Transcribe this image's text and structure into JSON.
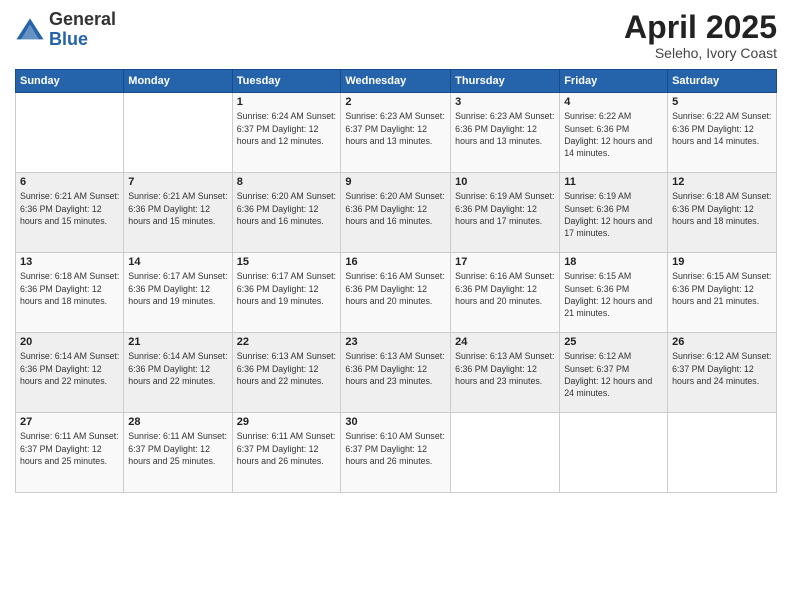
{
  "header": {
    "logo_general": "General",
    "logo_blue": "Blue",
    "month_title": "April 2025",
    "subtitle": "Seleho, Ivory Coast"
  },
  "weekdays": [
    "Sunday",
    "Monday",
    "Tuesday",
    "Wednesday",
    "Thursday",
    "Friday",
    "Saturday"
  ],
  "weeks": [
    [
      {
        "day": "",
        "info": ""
      },
      {
        "day": "",
        "info": ""
      },
      {
        "day": "1",
        "info": "Sunrise: 6:24 AM\nSunset: 6:37 PM\nDaylight: 12 hours and 12 minutes."
      },
      {
        "day": "2",
        "info": "Sunrise: 6:23 AM\nSunset: 6:37 PM\nDaylight: 12 hours and 13 minutes."
      },
      {
        "day": "3",
        "info": "Sunrise: 6:23 AM\nSunset: 6:36 PM\nDaylight: 12 hours and 13 minutes."
      },
      {
        "day": "4",
        "info": "Sunrise: 6:22 AM\nSunset: 6:36 PM\nDaylight: 12 hours and 14 minutes."
      },
      {
        "day": "5",
        "info": "Sunrise: 6:22 AM\nSunset: 6:36 PM\nDaylight: 12 hours and 14 minutes."
      }
    ],
    [
      {
        "day": "6",
        "info": "Sunrise: 6:21 AM\nSunset: 6:36 PM\nDaylight: 12 hours and 15 minutes."
      },
      {
        "day": "7",
        "info": "Sunrise: 6:21 AM\nSunset: 6:36 PM\nDaylight: 12 hours and 15 minutes."
      },
      {
        "day": "8",
        "info": "Sunrise: 6:20 AM\nSunset: 6:36 PM\nDaylight: 12 hours and 16 minutes."
      },
      {
        "day": "9",
        "info": "Sunrise: 6:20 AM\nSunset: 6:36 PM\nDaylight: 12 hours and 16 minutes."
      },
      {
        "day": "10",
        "info": "Sunrise: 6:19 AM\nSunset: 6:36 PM\nDaylight: 12 hours and 17 minutes."
      },
      {
        "day": "11",
        "info": "Sunrise: 6:19 AM\nSunset: 6:36 PM\nDaylight: 12 hours and 17 minutes."
      },
      {
        "day": "12",
        "info": "Sunrise: 6:18 AM\nSunset: 6:36 PM\nDaylight: 12 hours and 18 minutes."
      }
    ],
    [
      {
        "day": "13",
        "info": "Sunrise: 6:18 AM\nSunset: 6:36 PM\nDaylight: 12 hours and 18 minutes."
      },
      {
        "day": "14",
        "info": "Sunrise: 6:17 AM\nSunset: 6:36 PM\nDaylight: 12 hours and 19 minutes."
      },
      {
        "day": "15",
        "info": "Sunrise: 6:17 AM\nSunset: 6:36 PM\nDaylight: 12 hours and 19 minutes."
      },
      {
        "day": "16",
        "info": "Sunrise: 6:16 AM\nSunset: 6:36 PM\nDaylight: 12 hours and 20 minutes."
      },
      {
        "day": "17",
        "info": "Sunrise: 6:16 AM\nSunset: 6:36 PM\nDaylight: 12 hours and 20 minutes."
      },
      {
        "day": "18",
        "info": "Sunrise: 6:15 AM\nSunset: 6:36 PM\nDaylight: 12 hours and 21 minutes."
      },
      {
        "day": "19",
        "info": "Sunrise: 6:15 AM\nSunset: 6:36 PM\nDaylight: 12 hours and 21 minutes."
      }
    ],
    [
      {
        "day": "20",
        "info": "Sunrise: 6:14 AM\nSunset: 6:36 PM\nDaylight: 12 hours and 22 minutes."
      },
      {
        "day": "21",
        "info": "Sunrise: 6:14 AM\nSunset: 6:36 PM\nDaylight: 12 hours and 22 minutes."
      },
      {
        "day": "22",
        "info": "Sunrise: 6:13 AM\nSunset: 6:36 PM\nDaylight: 12 hours and 22 minutes."
      },
      {
        "day": "23",
        "info": "Sunrise: 6:13 AM\nSunset: 6:36 PM\nDaylight: 12 hours and 23 minutes."
      },
      {
        "day": "24",
        "info": "Sunrise: 6:13 AM\nSunset: 6:36 PM\nDaylight: 12 hours and 23 minutes."
      },
      {
        "day": "25",
        "info": "Sunrise: 6:12 AM\nSunset: 6:37 PM\nDaylight: 12 hours and 24 minutes."
      },
      {
        "day": "26",
        "info": "Sunrise: 6:12 AM\nSunset: 6:37 PM\nDaylight: 12 hours and 24 minutes."
      }
    ],
    [
      {
        "day": "27",
        "info": "Sunrise: 6:11 AM\nSunset: 6:37 PM\nDaylight: 12 hours and 25 minutes."
      },
      {
        "day": "28",
        "info": "Sunrise: 6:11 AM\nSunset: 6:37 PM\nDaylight: 12 hours and 25 minutes."
      },
      {
        "day": "29",
        "info": "Sunrise: 6:11 AM\nSunset: 6:37 PM\nDaylight: 12 hours and 26 minutes."
      },
      {
        "day": "30",
        "info": "Sunrise: 6:10 AM\nSunset: 6:37 PM\nDaylight: 12 hours and 26 minutes."
      },
      {
        "day": "",
        "info": ""
      },
      {
        "day": "",
        "info": ""
      },
      {
        "day": "",
        "info": ""
      }
    ]
  ]
}
